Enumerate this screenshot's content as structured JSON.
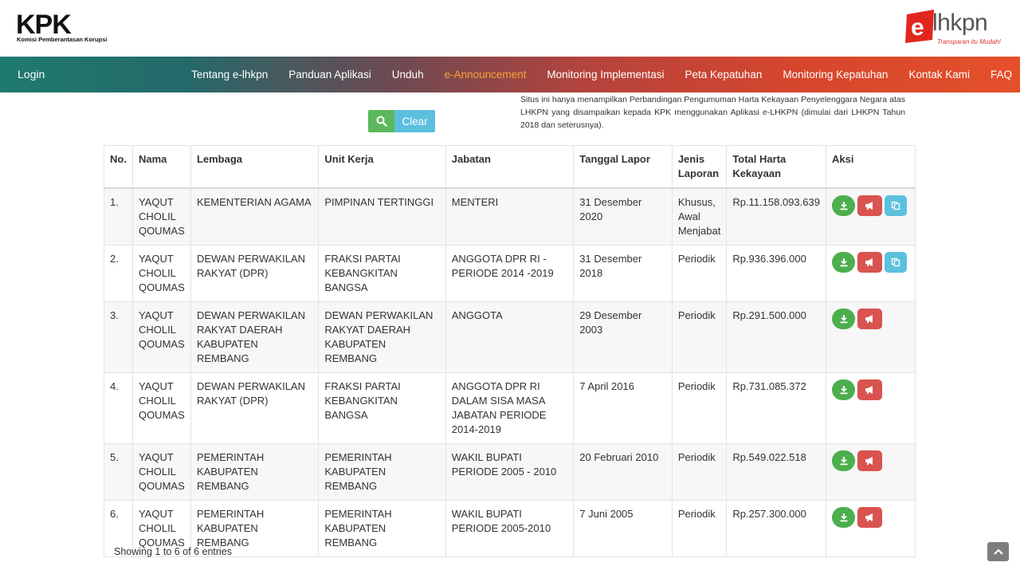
{
  "header": {
    "kpk_logo_text": "KPK",
    "kpk_subtitle": "Komisi Pemberantasan Korupsi",
    "elhkpn_logo_text": "lhkpn",
    "elhkpn_tagline": "Transparan itu Mudah!",
    "brand_red": "#e2261d"
  },
  "nav": {
    "login": "Login",
    "items": [
      "Tentang e-lhkpn",
      "Panduan Aplikasi",
      "Unduh",
      "e-Announcement",
      "Monitoring Implementasi",
      "Peta Kepatuhan",
      "Monitoring Kepatuhan",
      "Kontak Kami",
      "FAQ"
    ],
    "active_color": "#f6a23a"
  },
  "search": {
    "search_icon": "search-icon",
    "clear_label": "Clear"
  },
  "info_text": "Situs ini hanya menampilkan Perbandingan Pengumuman Harta Kekayaan Penyelenggara Negara atas LHKPN yang disampaikan kepada KPK menggunakan Aplikasi e-LHKPN (dimulai dari LHKPN Tahun 2018 dan seterusnya).",
  "table": {
    "headers": [
      "No.",
      "Nama",
      "Lembaga",
      "Unit Kerja",
      "Jabatan",
      "Tanggal Lapor",
      "Jenis Laporan",
      "Total Harta Kekayaan",
      "Aksi"
    ],
    "rows": [
      {
        "no": "1.",
        "nama": "YAQUT CHOLIL QOUMAS",
        "lembaga": "KEMENTERIAN AGAMA",
        "unit": "PIMPINAN TERTINGGI",
        "jabatan": "MENTERI",
        "tanggal": "31 Desember 2020",
        "jenis": "Khusus, Awal Menjabat",
        "total": "Rp.11.158.093.639"
      },
      {
        "no": "2.",
        "nama": "YAQUT CHOLIL QOUMAS",
        "lembaga": "DEWAN PERWAKILAN RAKYAT (DPR)",
        "unit": "FRAKSI PARTAI KEBANGKITAN BANGSA",
        "jabatan": "ANGGOTA DPR RI - PERIODE 2014 -2019",
        "tanggal": "31 Desember 2018",
        "jenis": "Periodik",
        "total": "Rp.936.396.000"
      },
      {
        "no": "3.",
        "nama": "YAQUT CHOLIL QOUMAS",
        "lembaga": "DEWAN PERWAKILAN RAKYAT DAERAH KABUPATEN REMBANG",
        "unit": "DEWAN PERWAKILAN RAKYAT DAERAH KABUPATEN REMBANG",
        "jabatan": "ANGGOTA",
        "tanggal": "29 Desember 2003",
        "jenis": "Periodik",
        "total": "Rp.291.500.000"
      },
      {
        "no": "4.",
        "nama": "YAQUT CHOLIL QOUMAS",
        "lembaga": "DEWAN PERWAKILAN RAKYAT (DPR)",
        "unit": "FRAKSI PARTAI KEBANGKITAN BANGSA",
        "jabatan": "ANGGOTA DPR RI DALAM SISA MASA JABATAN PERIODE 2014-2019",
        "tanggal": "7 April 2016",
        "jenis": "Periodik",
        "total": "Rp.731.085.372"
      },
      {
        "no": "5.",
        "nama": "YAQUT CHOLIL QOUMAS",
        "lembaga": "PEMERINTAH KABUPATEN REMBANG",
        "unit": "PEMERINTAH KABUPATEN REMBANG",
        "jabatan": "WAKIL BUPATI PERIODE 2005 - 2010",
        "tanggal": "20 Februari 2010",
        "jenis": "Periodik",
        "total": "Rp.549.022.518"
      },
      {
        "no": "6.",
        "nama": "YAQUT CHOLIL QOUMAS",
        "lembaga": "PEMERINTAH KABUPATEN REMBANG",
        "unit": "PEMERINTAH KABUPATEN REMBANG",
        "jabatan": "WAKIL BUPATI PERIODE 2005-2010",
        "tanggal": "7 Juni 2005",
        "jenis": "Periodik",
        "total": "Rp.257.300.000"
      }
    ]
  },
  "footer": {
    "entries_info": "Showing 1 to 6 of 6 entries",
    "scroll_top_icon": "chevron-up-icon"
  }
}
